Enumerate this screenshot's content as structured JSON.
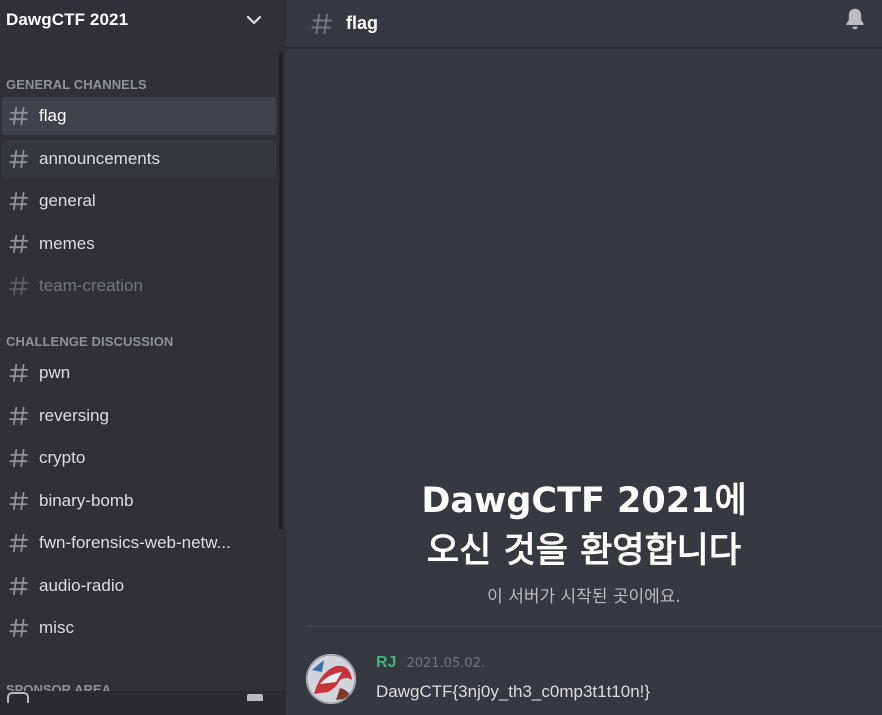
{
  "server": {
    "name": "DawgCTF 2021"
  },
  "categories": [
    {
      "title": "GENERAL CHANNELS",
      "channels": [
        {
          "name": "flag"
        },
        {
          "name": "announcements"
        },
        {
          "name": "general"
        },
        {
          "name": "memes"
        },
        {
          "name": "team-creation"
        }
      ]
    },
    {
      "title": "CHALLENGE DISCUSSION",
      "channels": [
        {
          "name": "pwn"
        },
        {
          "name": "reversing"
        },
        {
          "name": "crypto"
        },
        {
          "name": "binary-bomb"
        },
        {
          "name": "fwn-forensics-web-netw..."
        },
        {
          "name": "audio-radio"
        },
        {
          "name": "misc"
        }
      ]
    }
  ],
  "sponsor_peek": "SPONSOR AREA",
  "header": {
    "channel": "flag"
  },
  "welcome": {
    "line1": "DawgCTF 2021에",
    "line2": "오신 것을 환영합니다",
    "subtitle": "이 서버가 시작된 곳이에요."
  },
  "message": {
    "username": "RJ",
    "timestamp": "2021.05.02.",
    "text": "DawgCTF{3nj0y_th3_c0mp3t1t10n!}"
  },
  "colors": {
    "sidebar": "#2f3136",
    "main": "#36393f",
    "username": "#43b581",
    "selected": "#3f4248"
  }
}
